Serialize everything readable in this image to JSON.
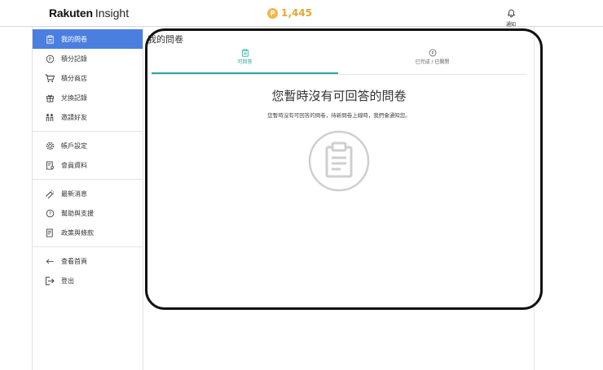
{
  "header": {
    "brand": "Rakuten",
    "brand_sub": "Insight",
    "points_coin_symbol": "P",
    "points": "1,445",
    "notification_label": "通知",
    "notification_icon": "bell-icon"
  },
  "sidebar": {
    "items": [
      {
        "label": "我的問卷",
        "icon": "clipboard-icon",
        "active": true
      },
      {
        "label": "積分記錄",
        "icon": "points-icon"
      },
      {
        "label": "積分商店",
        "icon": "cart-icon"
      },
      {
        "label": "兌換記錄",
        "icon": "gift-icon"
      },
      {
        "label": "邀請好友",
        "icon": "invite-icon"
      },
      {
        "label": "帳戶設定",
        "icon": "gear-icon"
      },
      {
        "label": "會員資料",
        "icon": "profile-icon"
      },
      {
        "label": "最新消息",
        "icon": "megaphone-icon"
      },
      {
        "label": "幫助與支援",
        "icon": "help-icon"
      },
      {
        "label": "政策與條款",
        "icon": "policy-icon"
      },
      {
        "label": "查看首頁",
        "icon": "arrow-left-icon"
      },
      {
        "label": "登出",
        "icon": "logout-icon"
      }
    ]
  },
  "main": {
    "title": "我的問卷",
    "tabs": [
      {
        "label": "可回答",
        "icon": "clipboard-icon",
        "active": true
      },
      {
        "label": "已完成 / 已關閉",
        "icon": "points-icon"
      }
    ],
    "empty_title": "您暫時沒有可回答的問卷",
    "empty_desc": "您暫時沒有可回答的問卷，待新問卷上線時，我們會通知您。",
    "empty_icon": "clipboard-icon"
  },
  "colors": {
    "accent_blue": "#4a7fe0",
    "tab_teal": "#2ba6a4",
    "points_gold": "#e6a634"
  }
}
